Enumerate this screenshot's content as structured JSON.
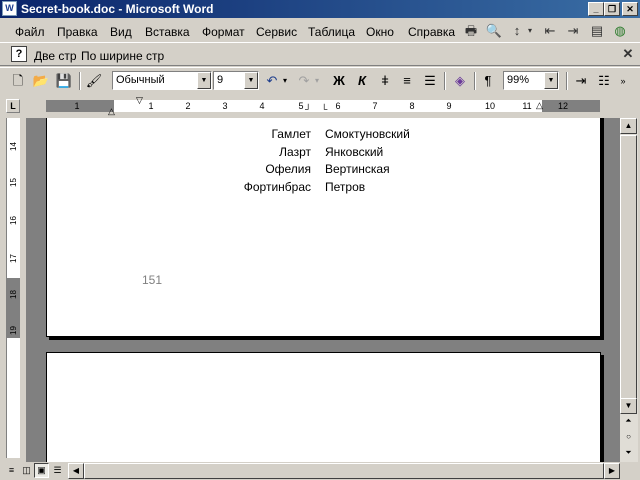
{
  "window": {
    "title": "Secret-book.doc - Microsoft Word",
    "icon": "W"
  },
  "menu": {
    "items": [
      "Файл",
      "Правка",
      "Вид",
      "Вставка",
      "Формат",
      "Сервис",
      "Таблица",
      "Окно",
      "Справка"
    ]
  },
  "reading_toolbar": {
    "two_pages": "Две стр",
    "fit_width": "По ширине стр"
  },
  "formatting_toolbar": {
    "style": "Обычный",
    "font_size": "9",
    "zoom": "99%",
    "bold": "Ж",
    "italic": "К",
    "pilcrow": "¶"
  },
  "ruler": {
    "numbers": [
      "1",
      "2",
      "1",
      "2",
      "3",
      "4",
      "5",
      "6",
      "7",
      "8",
      "9",
      "10",
      "11",
      "12"
    ],
    "vertical_numbers": [
      "14",
      "15",
      "16",
      "17",
      "18",
      "19"
    ]
  },
  "document": {
    "cast": [
      {
        "role": "Гамлет",
        "actor": "Смоктуновский"
      },
      {
        "role": "Лазрт",
        "actor": "Янковский"
      },
      {
        "role": "Офелия",
        "actor": "Вертинская"
      },
      {
        "role": "Фортинбрас",
        "actor": "Петров"
      }
    ],
    "page_number": "151"
  }
}
